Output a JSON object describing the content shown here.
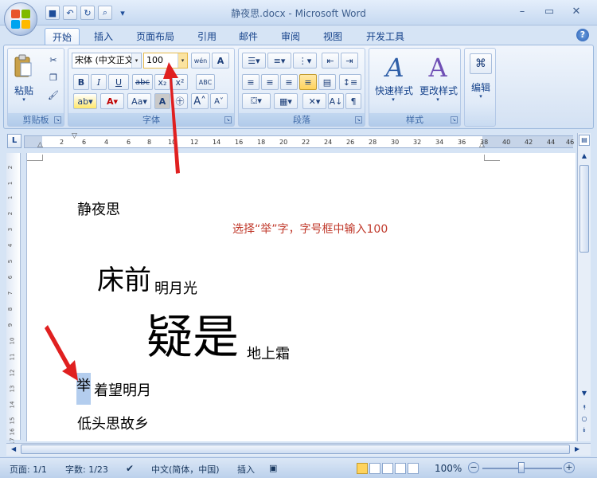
{
  "window": {
    "title": "静夜思.docx - Microsoft Word"
  },
  "tabs": [
    "开始",
    "插入",
    "页面布局",
    "引用",
    "邮件",
    "审阅",
    "视图",
    "开发工具"
  ],
  "ribbon": {
    "clipboard": {
      "label": "剪贴板",
      "paste": "粘贴"
    },
    "font": {
      "label": "字体",
      "font_name": "宋体 (中文正文",
      "font_size": "100",
      "wen_icon": "wén",
      "bold": "B",
      "italic": "I",
      "underline": "U",
      "strike": "abc",
      "sub": "x₂",
      "sup": "x²",
      "change_case": "Aa",
      "grow": "A",
      "shrink": "A"
    },
    "paragraph": {
      "label": "段落"
    },
    "styles": {
      "label": "样式",
      "quick": "快速样式",
      "change": "更改样式"
    },
    "editing": {
      "label": "编辑"
    }
  },
  "ruler": {
    "ticks": [
      "2",
      "2",
      "4",
      "6",
      "8",
      "10",
      "12",
      "14",
      "16",
      "18",
      "20",
      "22",
      "24",
      "26",
      "28",
      "30",
      "32",
      "34",
      "36",
      "38",
      "40",
      "42",
      "44",
      "46"
    ],
    "vticks": [
      "2",
      "1",
      "1",
      "2",
      "3",
      "4",
      "5",
      "6",
      "7",
      "8",
      "9",
      "10",
      "11",
      "12",
      "13",
      "14",
      "15",
      "16",
      "17"
    ]
  },
  "document": {
    "title": "静夜思",
    "annotation": "选择“举”字，字号框中输入100",
    "line1_big": "床前",
    "line1_rest": "明月光",
    "line2_big": "疑是",
    "line2_rest": "地上霜",
    "line3_sel": "举",
    "line3_rest": "着望明月",
    "line4": "低头思故乡"
  },
  "status": {
    "page": "页面: 1/1",
    "words": "字数: 1/23",
    "lang": "中文(简体，中国)",
    "mode": "插入",
    "zoom": "100%"
  },
  "colors": {
    "annotation": "#c0392b",
    "arrow": "#e02020",
    "selection": "#b3cdee"
  }
}
